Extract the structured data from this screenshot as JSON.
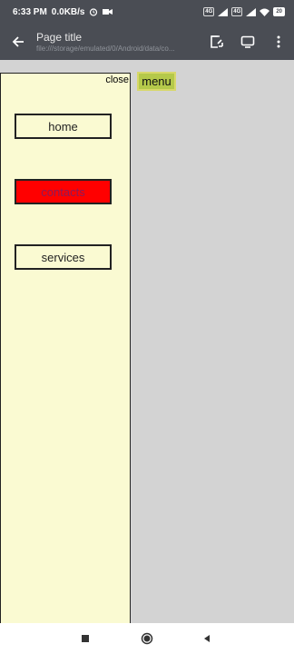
{
  "status_bar": {
    "time": "6:33 PM",
    "speed": "0.0KB/s",
    "sim1": "4G",
    "sim2": "4G",
    "battery": "20"
  },
  "app_bar": {
    "title": "Page title",
    "url": "file:///storage/emulated/0/Android/data/co..."
  },
  "side_nav": {
    "close_label": "close",
    "items": [
      {
        "label": "home"
      },
      {
        "label": "contacts"
      },
      {
        "label": "services"
      }
    ]
  },
  "menu_button": {
    "label": "menu"
  },
  "colors": {
    "bar_background": "#4a4d54",
    "page_background": "#d3d3d3",
    "side_nav_background": "#fafad2",
    "active_item_background": "#ff0000",
    "menu_button_background": "#b5c94a"
  },
  "icons": {
    "back": "arrow-back-icon",
    "open_external": "open-in-icon",
    "desktop": "desktop-icon",
    "more": "more-vertical-icon",
    "nav_recent": "square-icon",
    "nav_home": "circle-icon",
    "nav_back": "triangle-back-icon"
  }
}
